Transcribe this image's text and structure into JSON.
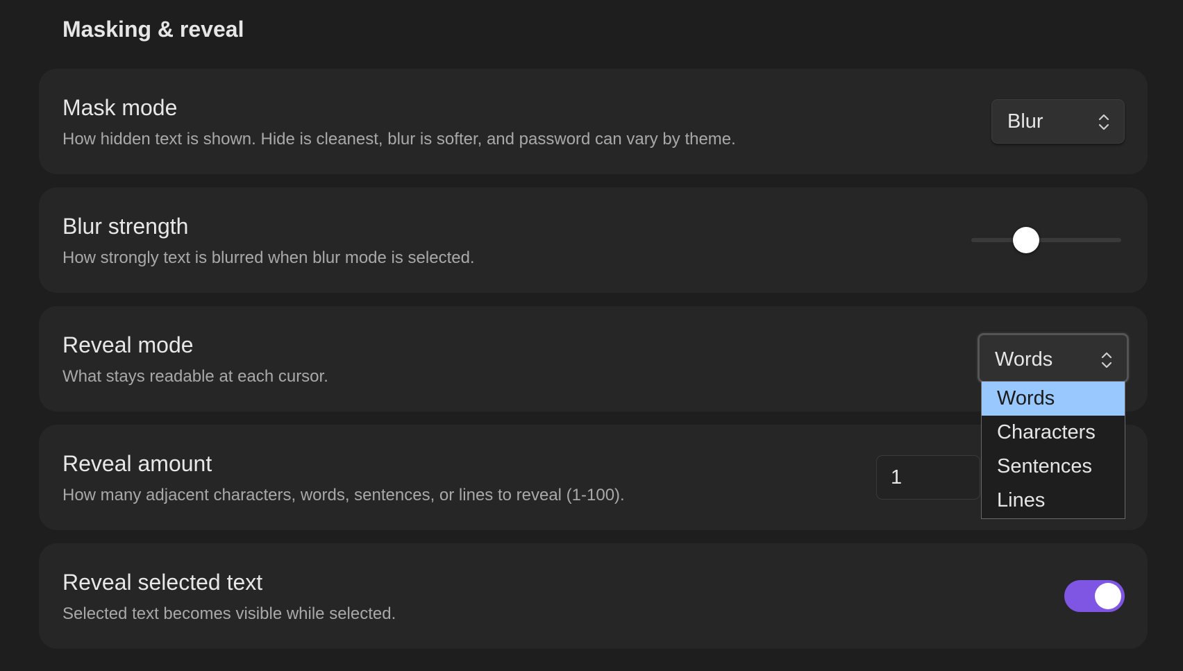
{
  "section": {
    "title": "Masking & reveal"
  },
  "settings": {
    "mask_mode": {
      "title": "Mask mode",
      "description": "How hidden text is shown. Hide is cleanest, blur is softer, and password can vary by theme.",
      "value": "Blur"
    },
    "blur_strength": {
      "title": "Blur strength",
      "description": "How strongly text is blurred when blur mode is selected.",
      "slider_fraction": 0.37
    },
    "reveal_mode": {
      "title": "Reveal mode",
      "description": "What stays readable at each cursor.",
      "value": "Words",
      "options": [
        "Words",
        "Characters",
        "Sentences",
        "Lines"
      ],
      "highlighted_option": "Words"
    },
    "reveal_amount": {
      "title": "Reveal amount",
      "description": "How many adjacent characters, words, sentences, or lines to reveal (1-100).",
      "value": "1"
    },
    "reveal_selected": {
      "title": "Reveal selected text",
      "description": "Selected text becomes visible while selected.",
      "enabled": true
    }
  },
  "colors": {
    "toggle_on": "#7f56e3",
    "dropdown_highlight": "#99c8ff",
    "card_bg": "#262626",
    "page_bg": "#1e1e1e"
  },
  "icons": {
    "select_chevron": "chevron-up-down-icon"
  }
}
